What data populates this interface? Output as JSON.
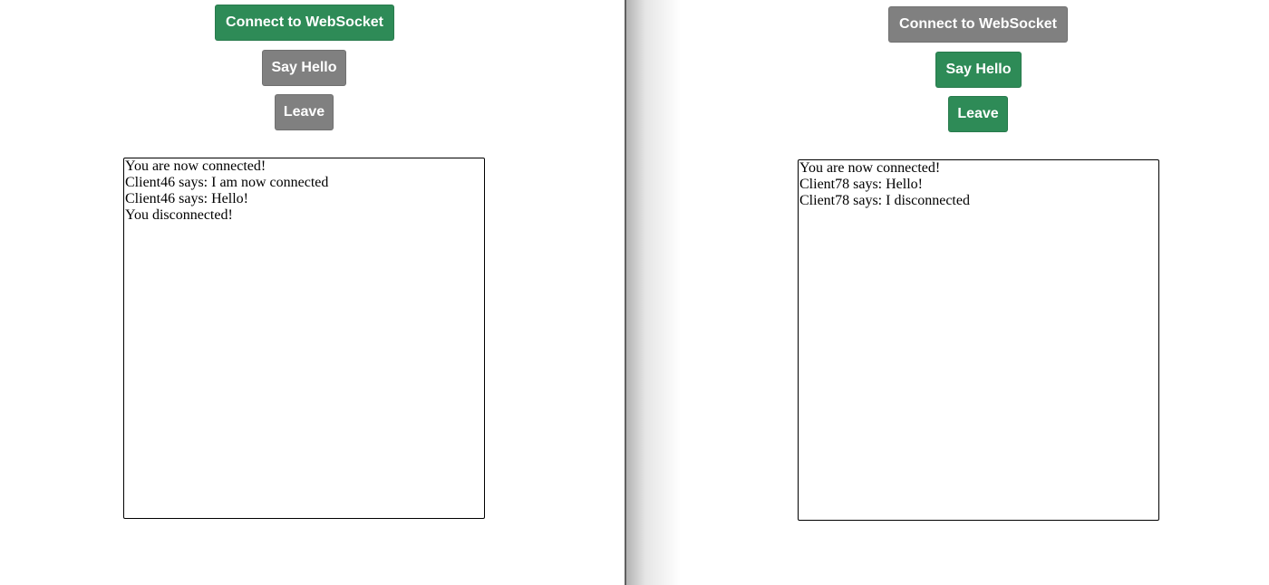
{
  "left_client": {
    "buttons": {
      "connect": "Connect to WebSocket",
      "say_hello": "Say Hello",
      "leave": "Leave"
    },
    "button_states": {
      "connect": "enabled",
      "say_hello": "disabled",
      "leave": "disabled"
    },
    "messages": [
      "You are now connected!",
      "Client46 says: I am now connected",
      "Client46 says: Hello!",
      "You disconnected!"
    ]
  },
  "right_client": {
    "buttons": {
      "connect": "Connect to WebSocket",
      "say_hello": "Say Hello",
      "leave": "Leave"
    },
    "button_states": {
      "connect": "disabled",
      "say_hello": "enabled",
      "leave": "enabled"
    },
    "messages": [
      "You are now connected!",
      "Client78 says: Hello!",
      "Client78 says: I disconnected"
    ]
  },
  "colors": {
    "enabled_button": "#2e8b57",
    "disabled_button": "#808080",
    "divider": "#5f5f5f"
  }
}
